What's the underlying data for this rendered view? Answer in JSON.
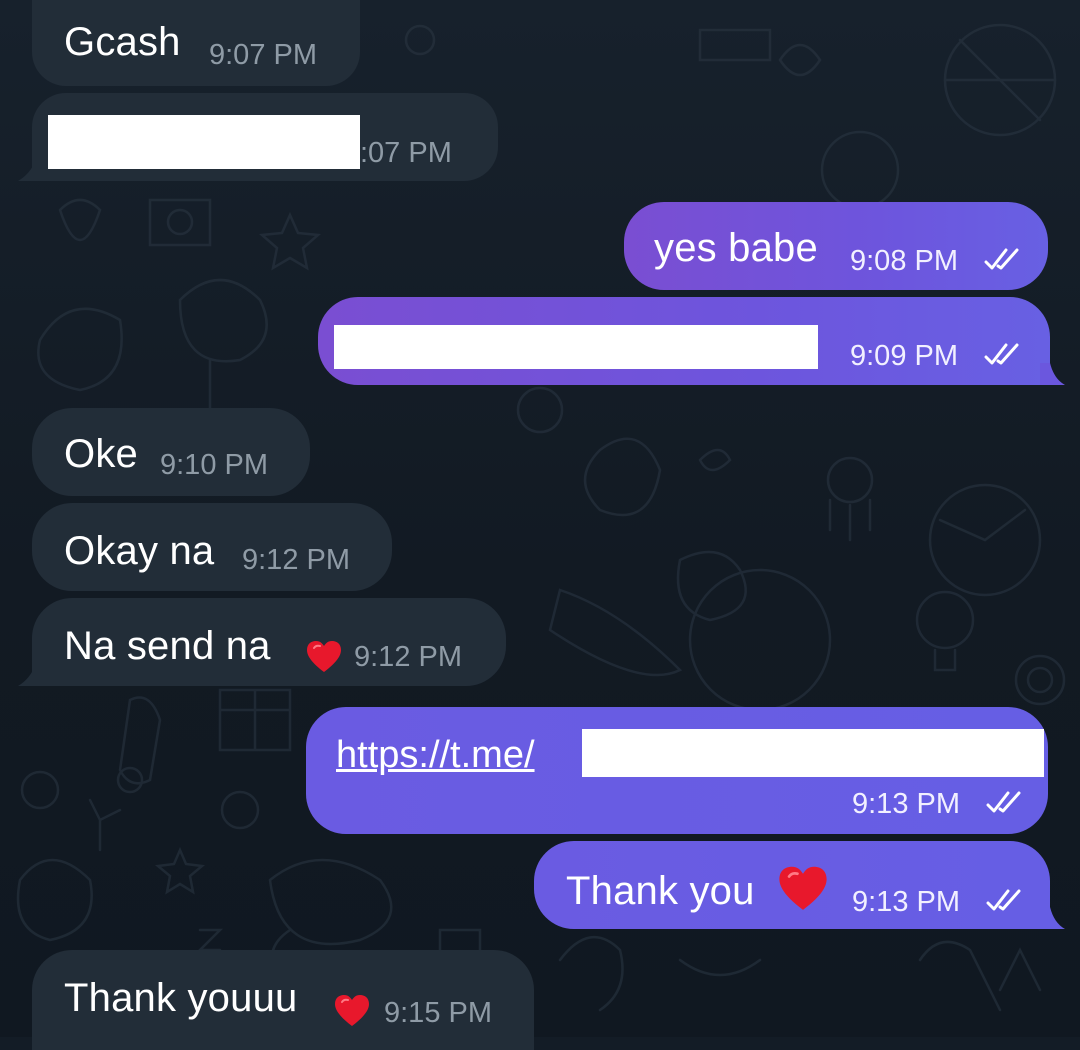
{
  "colors": {
    "background": "#131c26",
    "incoming_bubble": "#222d38",
    "outgoing_bubble_purple": "#7a4ed2",
    "outgoing_bubble_blue": "#665ee4",
    "incoming_time": "#8f9ba6",
    "heart": "#e8182c"
  },
  "messages": [
    {
      "direction": "incoming",
      "text": "Gcash",
      "time": "9:07 PM"
    },
    {
      "direction": "incoming",
      "text": "",
      "time": ":07 PM",
      "redacted": true
    },
    {
      "direction": "outgoing",
      "text": "yes babe",
      "time": "9:08 PM",
      "status_icon": "double-check-icon"
    },
    {
      "direction": "outgoing",
      "text": "",
      "time": "9:09 PM",
      "redacted": true,
      "status_icon": "double-check-icon"
    },
    {
      "direction": "incoming",
      "text": "Oke",
      "time": "9:10 PM"
    },
    {
      "direction": "incoming",
      "text": "Okay na",
      "time": "9:12 PM"
    },
    {
      "direction": "incoming",
      "text": "Na send na",
      "time": "9:12 PM",
      "reaction": "heart-icon"
    },
    {
      "direction": "outgoing",
      "text": "https://t.me/",
      "time": "9:13 PM",
      "redacted": true,
      "is_link": true,
      "status_icon": "double-check-icon"
    },
    {
      "direction": "outgoing",
      "text": "Thank you",
      "time": "9:13 PM",
      "emoji": "heart-icon",
      "status_icon": "double-check-icon"
    },
    {
      "direction": "incoming",
      "text": "Thank youuu",
      "time": "9:15 PM",
      "reaction": "heart-icon"
    }
  ]
}
